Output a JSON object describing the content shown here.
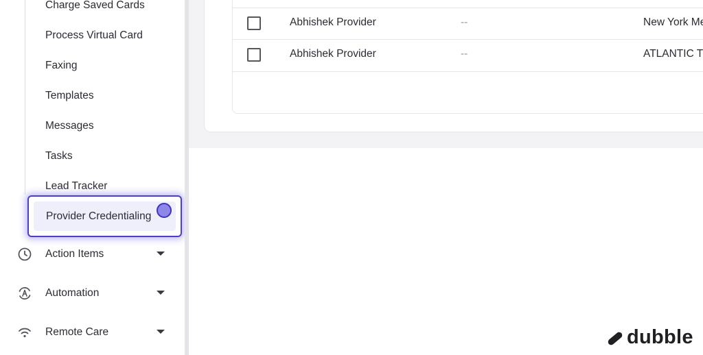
{
  "sidebar": {
    "sub_items": [
      {
        "label": "Charge Saved Cards"
      },
      {
        "label": "Process Virtual Card"
      },
      {
        "label": "Faxing"
      },
      {
        "label": "Templates"
      },
      {
        "label": "Messages"
      },
      {
        "label": "Tasks"
      },
      {
        "label": "Lead Tracker"
      }
    ],
    "active_item": {
      "label": "Provider Credentialing"
    },
    "groups": [
      {
        "label": "Action Items",
        "icon": "clock-icon"
      },
      {
        "label": "Automation",
        "icon": "automation-icon"
      },
      {
        "label": "Remote Care",
        "icon": "wifi-icon"
      }
    ]
  },
  "table": {
    "rows": [
      {
        "name": "Abhishek Provider",
        "value": "--",
        "location": "New York Me"
      },
      {
        "name": "Abhishek Provider",
        "value": "--",
        "location": "ATLANTIC T"
      }
    ]
  },
  "brand": {
    "logo_text": "dubble",
    "logo_icon": "dubble-logo-icon"
  }
}
